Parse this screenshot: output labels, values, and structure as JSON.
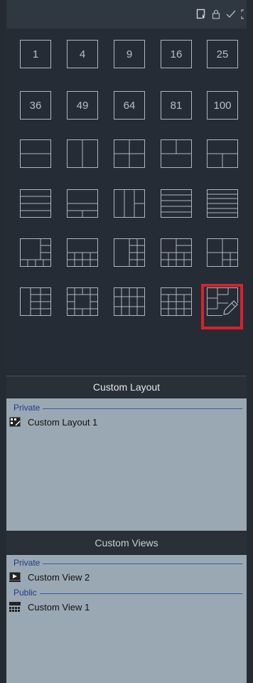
{
  "toolbar": {
    "icons": [
      "edit-layout-icon",
      "lock-icon",
      "check-icon",
      "fullscreen-icon"
    ]
  },
  "layouts": {
    "number_row_1": [
      "1",
      "4",
      "9",
      "16",
      "25"
    ],
    "number_row_2": [
      "36",
      "49",
      "64",
      "81",
      "100"
    ]
  },
  "custom_layout": {
    "header": "Custom Layout",
    "groups": [
      {
        "label": "Private",
        "items": [
          "Custom Layout 1"
        ]
      }
    ]
  },
  "custom_views": {
    "header": "Custom Views",
    "groups": [
      {
        "label": "Private",
        "items": [
          "Custom View 2"
        ]
      },
      {
        "label": "Public",
        "items": [
          "Custom View 1"
        ]
      }
    ]
  },
  "colors": {
    "highlight": "#d9212b",
    "panel": "#9aa8b3",
    "dark": "#252b33"
  }
}
